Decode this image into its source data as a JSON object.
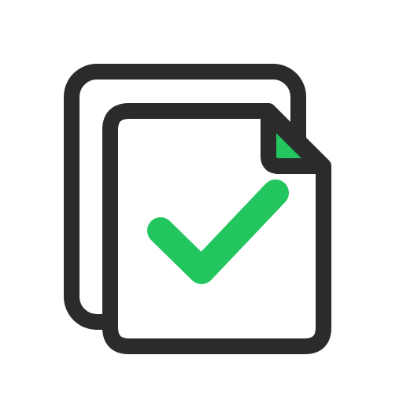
{
  "icon": {
    "name": "copy-document-check-icon",
    "colors": {
      "stroke": "#2b2b2b",
      "fill": "#ffffff",
      "accent": "#22c55e"
    }
  }
}
